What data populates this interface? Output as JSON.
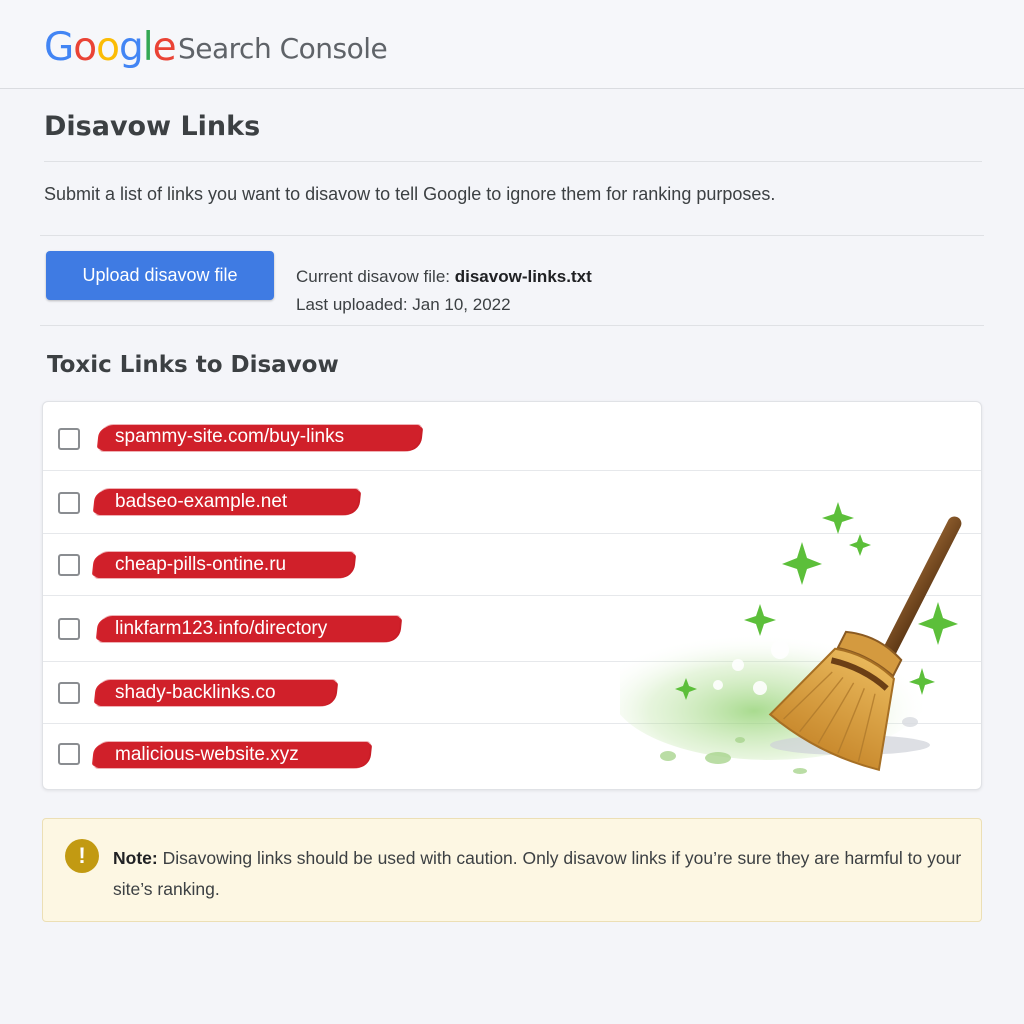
{
  "header": {
    "logo_letters": [
      {
        "ch": "G",
        "color": "#4285F4"
      },
      {
        "ch": "o",
        "color": "#EA4335"
      },
      {
        "ch": "o",
        "color": "#FBBC05"
      },
      {
        "ch": "g",
        "color": "#4285F4"
      },
      {
        "ch": "l",
        "color": "#34A853"
      },
      {
        "ch": "e",
        "color": "#EA4335"
      }
    ],
    "product_name": "Search Console"
  },
  "page": {
    "title": "Disavow Links",
    "description": "Submit a list of links you want to disavow to tell Google to ignore them for ranking purposes."
  },
  "upload": {
    "button_label": "Upload disavow file",
    "current_file_label": "Current disavow file:",
    "current_file_name": "disavow-links.txt",
    "last_uploaded": "Last uploaded: Jan 10, 2022"
  },
  "toxic_links": {
    "title": "Toxic Links to Disavow",
    "items": [
      {
        "url": "spammy-site.com/buy-links",
        "checked": false
      },
      {
        "url": "badseo-example.net",
        "checked": false
      },
      {
        "url": "cheap-pills-ontine.ru",
        "checked": false
      },
      {
        "url": "linkfarm123.info/directory",
        "checked": false
      },
      {
        "url": "shady-backlinks.co",
        "checked": false
      },
      {
        "url": "malicious-website.xyz",
        "checked": false
      }
    ]
  },
  "note": {
    "label": "Note:",
    "text": "Disavowing links should be used with caution. Only disavow links if you’re sure they are harmful to your site’s ranking.",
    "icon": "!"
  },
  "colors": {
    "accent": "#3f7be3",
    "strike": "#d0202a",
    "note_bg": "#fdf7e3",
    "note_icon": "#c29a12",
    "sparkle": "#5cbf3a"
  }
}
